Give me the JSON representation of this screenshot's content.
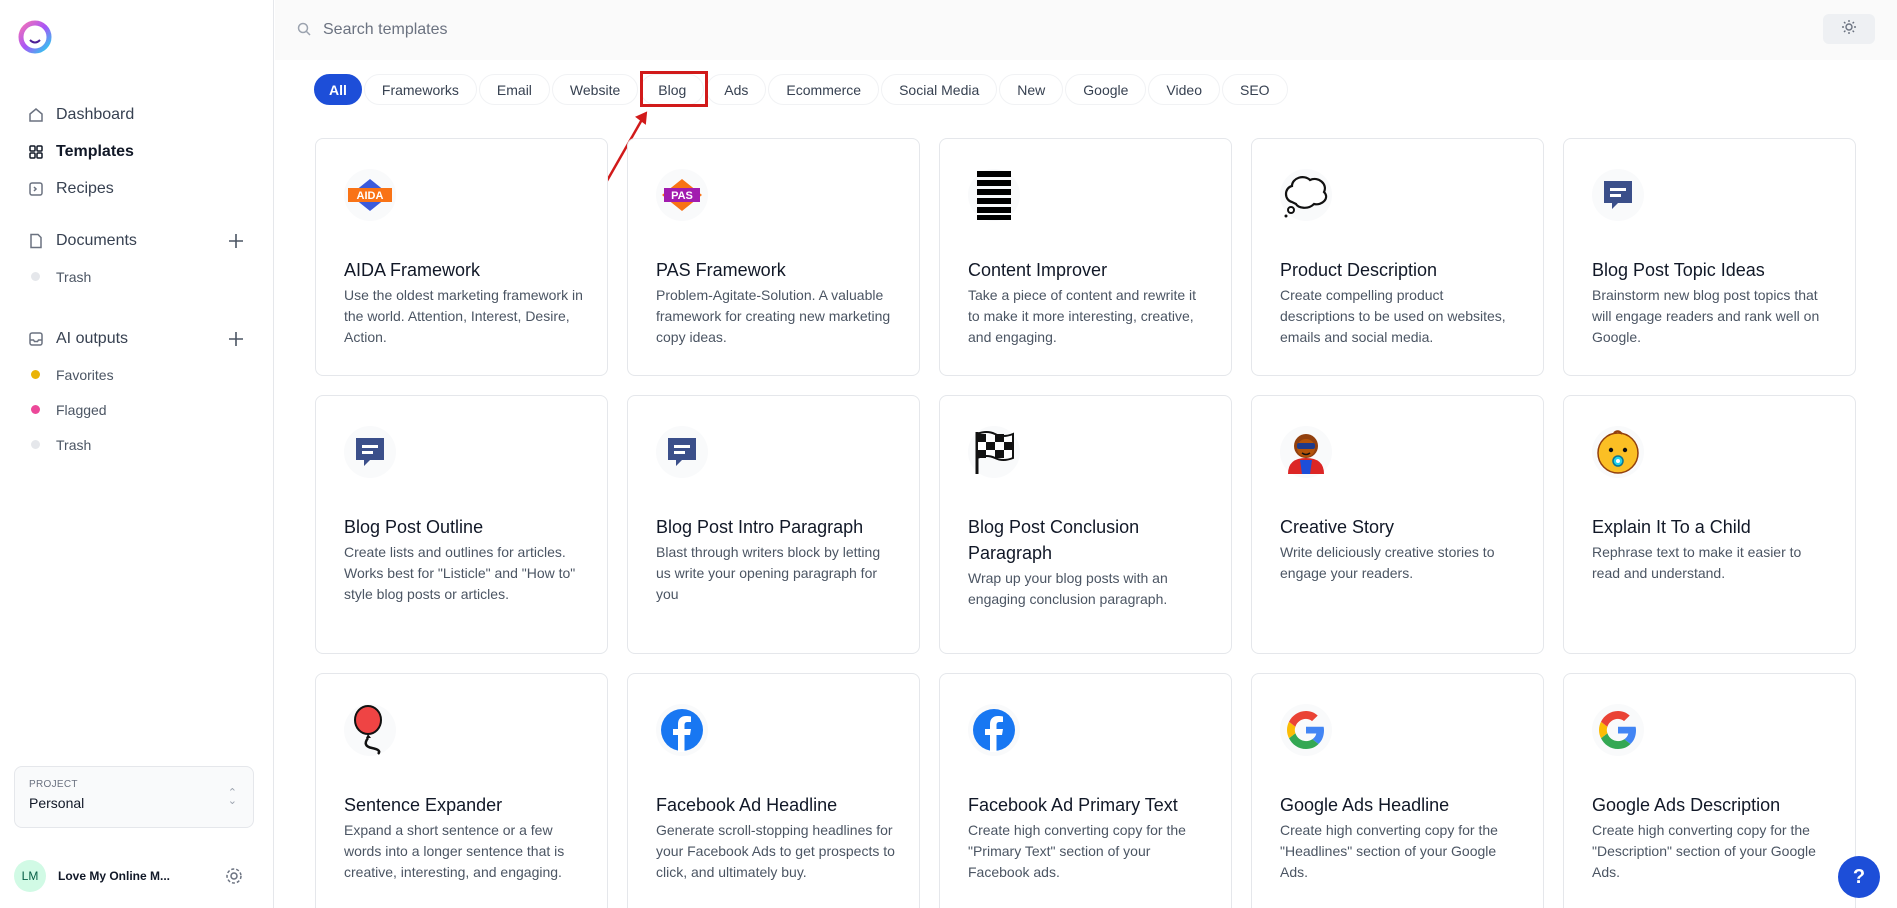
{
  "sidebar": {
    "nav": [
      {
        "label": "Dashboard",
        "icon": "home-icon"
      },
      {
        "label": "Templates",
        "icon": "grid-icon"
      },
      {
        "label": "Recipes",
        "icon": "terminal-icon"
      }
    ],
    "documents": {
      "label": "Documents",
      "items": [
        {
          "label": "Trash",
          "color": "#e5e7eb"
        }
      ]
    },
    "ai_outputs": {
      "label": "AI outputs",
      "items": [
        {
          "label": "Favorites",
          "color": "#eab308"
        },
        {
          "label": "Flagged",
          "color": "#ec4899"
        },
        {
          "label": "Trash",
          "color": "#e5e7eb"
        }
      ]
    },
    "project": {
      "label": "PROJECT",
      "value": "Personal"
    },
    "user": {
      "initials": "LM",
      "name": "Love My Online M..."
    }
  },
  "search": {
    "placeholder": "Search templates"
  },
  "tabs": [
    "All",
    "Frameworks",
    "Email",
    "Website",
    "Blog",
    "Ads",
    "Ecommerce",
    "Social Media",
    "New",
    "Google",
    "Video",
    "SEO"
  ],
  "active_tab": "All",
  "highlighted_tab": "Blog",
  "colors": {
    "accent": "#1d4ed8",
    "annotation": "#d11a1a"
  },
  "cards": [
    {
      "title": "AIDA Framework",
      "desc": "Use the oldest marketing framework in the world. Attention, Interest, Desire, Action.",
      "icon": "aida-badge-icon"
    },
    {
      "title": "PAS Framework",
      "desc": "Problem-Agitate-Solution. A valuable framework for creating new marketing copy ideas.",
      "icon": "pas-badge-icon"
    },
    {
      "title": "Content Improver",
      "desc": "Take a piece of content and rewrite it to make it more interesting, creative, and engaging.",
      "icon": "text-lines-icon"
    },
    {
      "title": "Product Description",
      "desc": "Create compelling product descriptions to be used on websites, emails and social media.",
      "icon": "thought-bubble-icon"
    },
    {
      "title": "Blog Post Topic Ideas",
      "desc": "Brainstorm new blog post topics that will engage readers and rank well on Google.",
      "icon": "chat-bubble-icon"
    },
    {
      "title": "Blog Post Outline",
      "desc": "Create lists and outlines for articles. Works best for \"Listicle\" and \"How to\" style blog posts or articles.",
      "icon": "chat-bubble-icon"
    },
    {
      "title": "Blog Post Intro Paragraph",
      "desc": "Blast through writers block by letting us write your opening paragraph for you",
      "icon": "chat-bubble-icon"
    },
    {
      "title": "Blog Post Conclusion Paragraph",
      "desc": "Wrap up your blog posts with an engaging conclusion paragraph.",
      "icon": "checkered-flag-icon"
    },
    {
      "title": "Creative Story",
      "desc": "Write deliciously creative stories to engage your readers.",
      "icon": "superhero-icon"
    },
    {
      "title": "Explain It To a Child",
      "desc": "Rephrase text to make it easier to read and understand.",
      "icon": "baby-icon"
    },
    {
      "title": "Sentence Expander",
      "desc": "Expand a short sentence or a few words into a longer sentence that is creative, interesting, and engaging.",
      "icon": "balloon-icon"
    },
    {
      "title": "Facebook Ad Headline",
      "desc": "Generate scroll-stopping headlines for your Facebook Ads to get prospects to click, and ultimately buy.",
      "icon": "facebook-icon"
    },
    {
      "title": "Facebook Ad Primary Text",
      "desc": "Create high converting copy for the \"Primary Text\" section of your Facebook ads.",
      "icon": "facebook-icon"
    },
    {
      "title": "Google Ads Headline",
      "desc": "Create high converting copy for the \"Headlines\" section of your Google Ads.",
      "icon": "google-icon"
    },
    {
      "title": "Google Ads Description",
      "desc": "Create high converting copy for the \"Description\" section of your Google Ads.",
      "icon": "google-icon"
    }
  ],
  "help": {
    "label": "?"
  }
}
